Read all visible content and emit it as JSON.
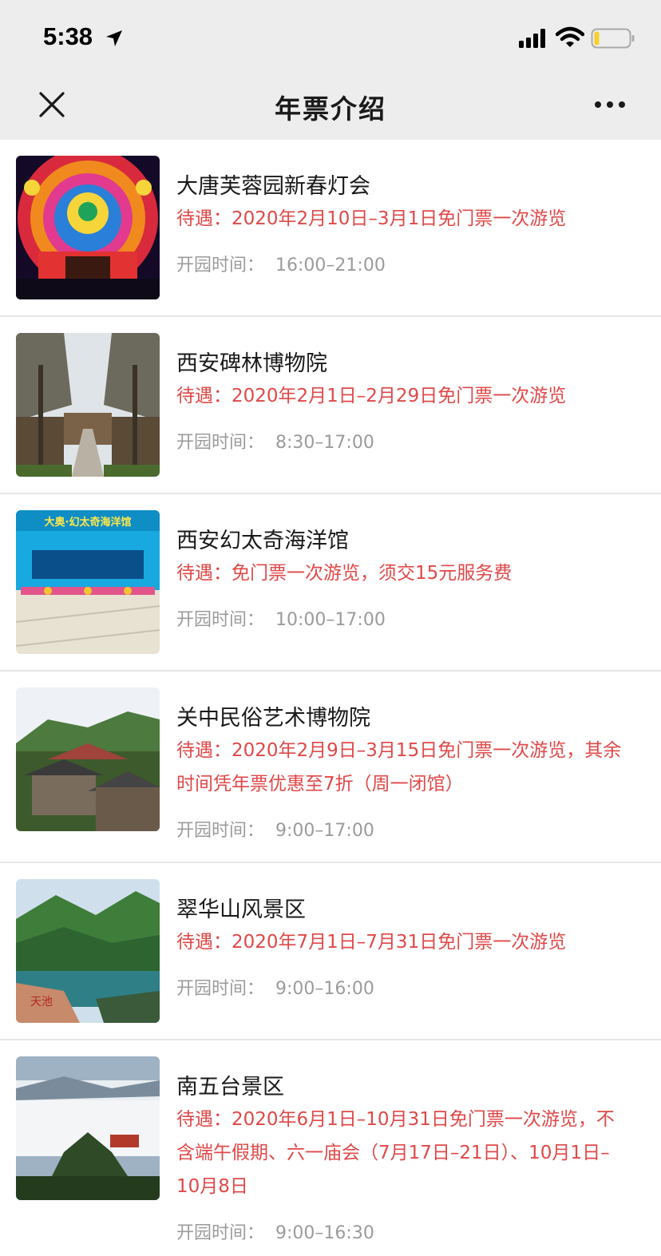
{
  "status_bar": {
    "time": "5:38"
  },
  "nav": {
    "title": "年票介绍"
  },
  "hours_label": "开园时间：",
  "items": [
    {
      "title": "大唐芙蓉园新春灯会",
      "benefit": "待遇：2020年2月10日–3月1日免门票一次游览",
      "hours": "16:00–21:00"
    },
    {
      "title": "西安碑林博物院",
      "benefit": "待遇：2020年2月1日–2月29日免门票一次游览",
      "hours": "8:30–17:00"
    },
    {
      "title": "西安幻太奇海洋馆",
      "benefit": "待遇：免门票一次游览，须交15元服务费",
      "hours": "10:00–17:00"
    },
    {
      "title": "关中民俗艺术博物院",
      "benefit": "待遇：2020年2月9日–3月15日免门票一次游览，其余时间凭年票优惠至7折（周一闭馆）",
      "hours": "9:00–17:00"
    },
    {
      "title": "翠华山风景区",
      "benefit": "待遇：2020年7月1日–7月31日免门票一次游览",
      "hours": "9:00–16:00"
    },
    {
      "title": "南五台景区",
      "benefit": "待遇：2020年6月1日–10月31日免门票一次游览，不含端午假期、六一庙会（7月17日–21日）、10月1日–10月8日",
      "hours": "9:00–16:30"
    }
  ],
  "image_text": {
    "aquarium_banner": "大奥·幻太奇海洋馆",
    "rock_inscription": "天池"
  },
  "icons": {
    "location": "location-arrow-icon",
    "signal": "signal-icon",
    "wifi": "wifi-icon",
    "battery": "battery-low-icon",
    "close": "close-icon",
    "more": "more-icon"
  },
  "colors": {
    "benefit": "#e04848",
    "hours": "#9b9b9b",
    "title": "#1a1a1a",
    "navbar_bg": "#ededed",
    "battery_level": "#f5d12a"
  }
}
